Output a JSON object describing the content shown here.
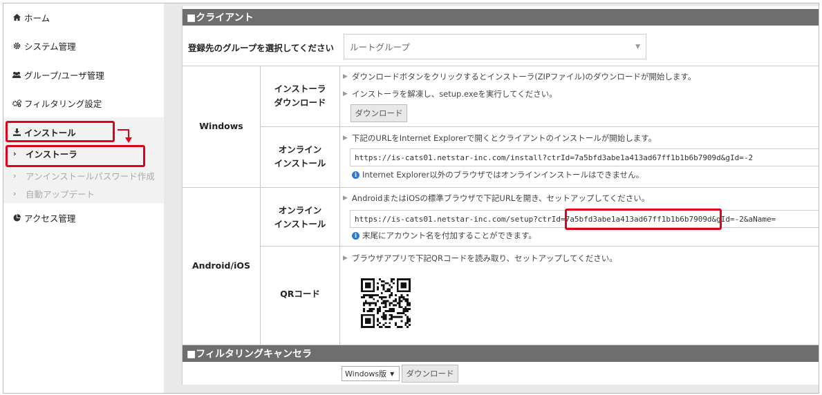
{
  "sidebar": {
    "home": "ホーム",
    "system": "システム管理",
    "group_user": "グループ/ユーザ管理",
    "filtering": "フィルタリング設定",
    "install": "インストール",
    "sub": {
      "installer": "インストーラ",
      "uninstall_pw": "アンインストールパスワード作成",
      "auto_update": "自動アップデート"
    },
    "access": "アクセス管理"
  },
  "client": {
    "header": "■クライアント",
    "group_label": "登録先のグループを選択してください",
    "group_value": "ルートグループ",
    "windows": {
      "label": "Windows",
      "installer_download": {
        "title_line1": "インストーラ",
        "title_line2": "ダウンロード",
        "hint1": "ダウンロードボタンをクリックするとインストーラ(ZIPファイル)のダウンロードが開始します。",
        "hint2": "インストーラを解凍し、setup.exeを実行してください。",
        "button": "ダウンロード"
      },
      "online_install": {
        "title_line1": "オンライン",
        "title_line2": "インストール",
        "hint": "下記のURLをInternet Explorerで開くとクライアントのインストールが開始します。",
        "url": "https://is-cats01.netstar-inc.com/install?ctrId=7a5bfd3abe1a413ad67ff1b1b6b7909d&gId=-2",
        "note": "Internet Explorer以外のブラウザではオンラインインストールはできません。"
      }
    },
    "android_ios": {
      "label": "Android/iOS",
      "online_install": {
        "title_line1": "オンライン",
        "title_line2": "インストール",
        "hint": "AndroidまたはiOSの標準ブラウザで下記URLを開き、セットアップしてください。",
        "url": "https://is-cats01.netstar-inc.com/setup?ctrId=7a5bfd3abe1a413ad67ff1b1b6b7909d&gId=-2&aName=",
        "note": "末尾にアカウント名を付加することができます。"
      },
      "qr": {
        "title": "QRコード",
        "hint": "ブラウザアプリで下記QRコードを読み取り、セットアップしてください。"
      }
    }
  },
  "canceller": {
    "header": "■フィルタリングキャンセラ",
    "os_select": "Windows版",
    "button": "ダウンロード"
  },
  "colors": {
    "highlight": "#e0001b",
    "header_bg": "#6e6e6e",
    "info": "#2b7bd4"
  }
}
